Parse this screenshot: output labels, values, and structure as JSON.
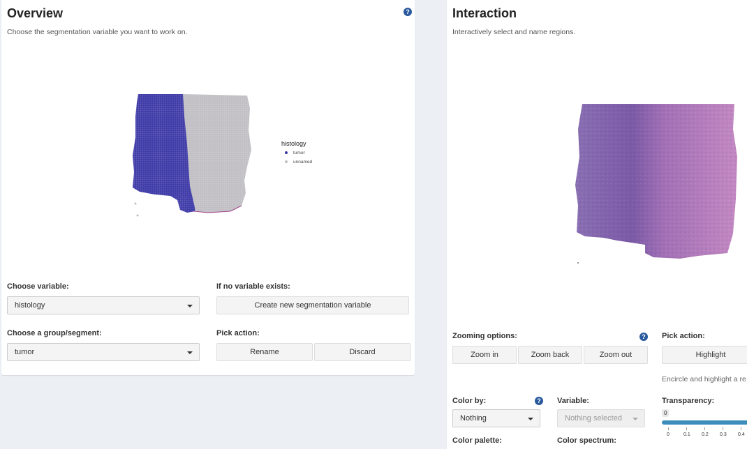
{
  "overview": {
    "title": "Overview",
    "subtitle": "Choose the segmentation variable you want to work on.",
    "help_icon": "question-icon",
    "legend": {
      "title": "histology",
      "items": [
        {
          "label": "tumor",
          "color": "#3a36a6"
        },
        {
          "label": "unnamed",
          "color": "#bfbdc2"
        }
      ]
    },
    "choose_variable_label": "Choose variable:",
    "choose_variable_value": "histology",
    "no_variable_label": "If no variable exists:",
    "create_button": "Create new segmentation variable",
    "choose_group_label": "Choose a group/segment:",
    "choose_group_value": "tumor",
    "pick_action_label": "Pick action:",
    "rename_button": "Rename",
    "discard_button": "Discard"
  },
  "interaction": {
    "title": "Interaction",
    "subtitle": "Interactively select and name regions.",
    "zooming_label": "Zooming options:",
    "help_icon": "question-icon",
    "zoom_in": "Zoom in",
    "zoom_back": "Zoom back",
    "zoom_out": "Zoom out",
    "pick_action_label": "Pick action:",
    "highlight_button": "Highlight",
    "highlight_hint": "Encircle and highlight a re",
    "color_by_label": "Color by:",
    "color_by_value": "Nothing",
    "variable_label": "Variable:",
    "variable_value": "Nothing selected",
    "transparency_label": "Transparency:",
    "transparency_value": 0,
    "transparency_ticks": [
      "0",
      "0.1",
      "0.2",
      "0.3",
      "0.4"
    ],
    "color_palette_label": "Color palette:",
    "color_spectrum_label": "Color spectrum:"
  },
  "colors": {
    "tumor": "#3a36a6",
    "unnamed": "#bfbdc2",
    "accent": "#3c8dbc",
    "help": "#2a5a9e"
  }
}
